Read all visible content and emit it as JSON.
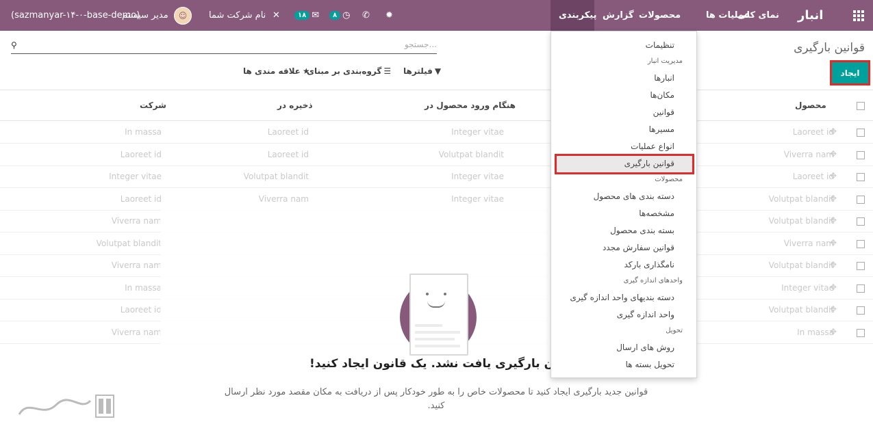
{
  "topbar": {
    "brand": "انبار",
    "menu": [
      "نمای کلی",
      "عملیات ها",
      "محصولات",
      "گزارش",
      "پیکربندی"
    ],
    "company": "نام شرکت شما",
    "user": "مدیر سیستم",
    "database": "(sazmanyar-۱۴-۰-base-demo)",
    "activity_count": "۸",
    "messages_count": "۱۸"
  },
  "page": {
    "title": "قوانین بارگیری",
    "create_button": "ایجاد",
    "search_placeholder": "جستجو...",
    "filters": "فیلترها",
    "group_by": "گروه‌بندی بر مبنای",
    "favorites": "علاقه مندی ها"
  },
  "table": {
    "columns": [
      "محصول",
      "هنگام ورود محصول در",
      "ذخیره در",
      "شرکت"
    ],
    "rows": [
      [
        "Laoreet id",
        "Integer vitae",
        "Laoreet id",
        "In massa"
      ],
      [
        "Viverra nam",
        "Volutpat blandit",
        "Laoreet id",
        "Laoreet id"
      ],
      [
        "Laoreet id",
        "Integer vitae",
        "Volutpat blandit",
        "Integer vitae"
      ],
      [
        "Volutpat blandit",
        "Integer vitae",
        "Viverra nam",
        "Laoreet id"
      ],
      [
        "Volutpat blandit",
        "",
        "",
        "Viverra nam"
      ],
      [
        "Viverra nam",
        "",
        "",
        "Volutpat blandit"
      ],
      [
        "Volutpat blandit",
        "",
        "",
        "Viverra nam"
      ],
      [
        "Integer vitae",
        "",
        "",
        "In massa"
      ],
      [
        "Volutpat blandit",
        "",
        "",
        "Laoreet id"
      ],
      [
        "In massa",
        "",
        "",
        "Viverra nam"
      ]
    ]
  },
  "help": {
    "title": "هیچ قانون بارگیری یافت نشد. یک قانون ایجاد کنید!",
    "body": "قوانین جدید بارگیری ایجاد کنید تا محصولات خاص را به طور خودکار پس از دریافت به مکان مقصد مورد نظر ارسال کنید."
  },
  "dropdown": {
    "settings": "تنظیمات",
    "section_warehouse": "مدیریت انبار",
    "warehouses": "انبارها",
    "locations": "مکان‌ها",
    "rules": "قوانین",
    "routes": "مسیرها",
    "operation_types": "انواع عملیات",
    "putaway_rules": "قوانین بارگیری",
    "section_products": "محصولات",
    "product_categories": "دسته بندی های محصول",
    "attributes": "مشخصه‌ها",
    "packagings": "بسته بندی محصول",
    "reorder_rules": "قوانین سفارش مجدد",
    "barcode_nomenclature": "نامگذاری بارکد",
    "section_uom": "واحدهای اندازه گیری",
    "uom_categories": "دسته بندیهای واحد اندازه گیری",
    "uom": "واحد اندازه گیری",
    "section_delivery": "تحویل",
    "shipping_methods": "روش های ارسال",
    "delivery_packages": "تحویل بسته ها"
  },
  "colors": {
    "primary": "#875a7b",
    "accent": "#00a09d",
    "highlight": "#e02b27"
  }
}
